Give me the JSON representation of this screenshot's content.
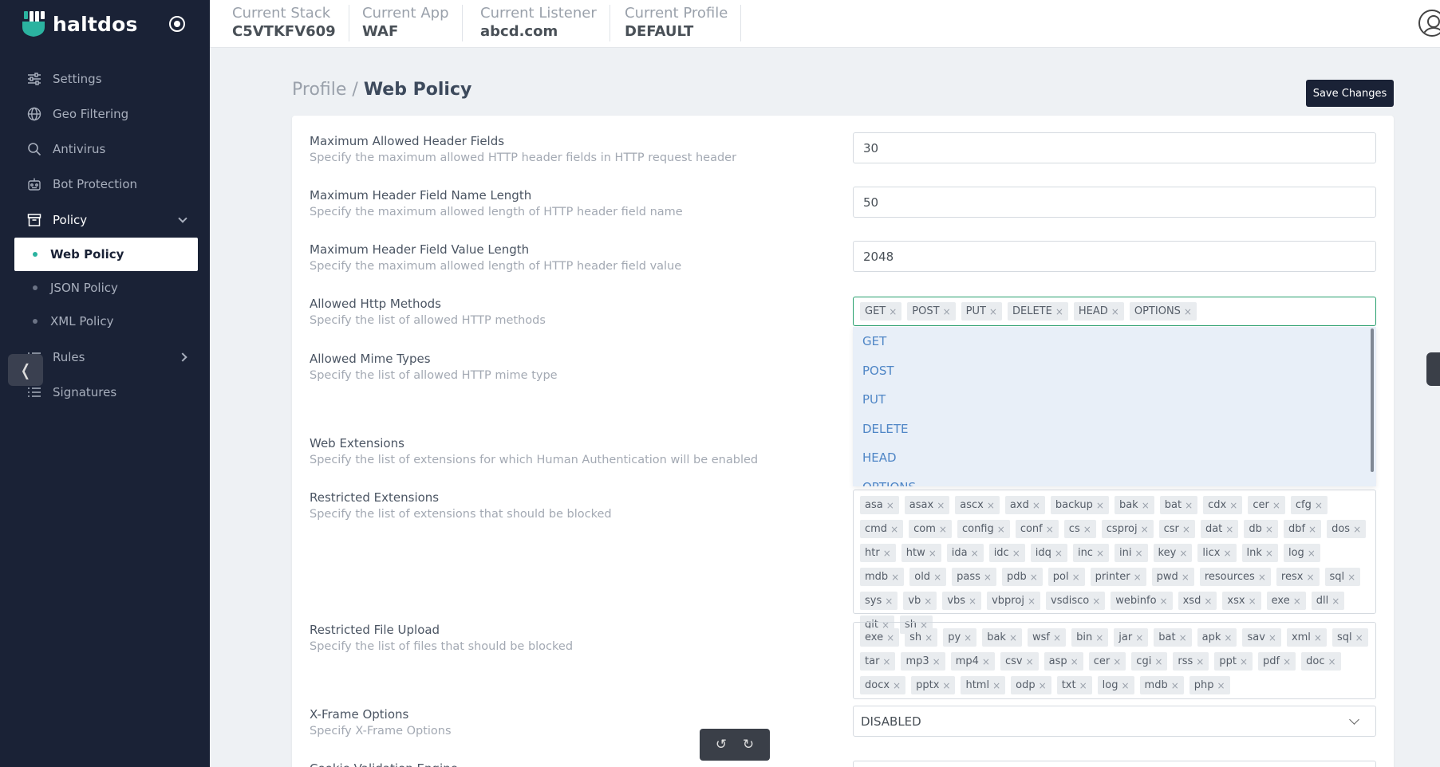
{
  "brand": {
    "name": "haltdos"
  },
  "sidebar": {
    "items": [
      {
        "label": "Settings",
        "icon": "sliders-icon"
      },
      {
        "label": "Geo Filtering",
        "icon": "globe-icon"
      },
      {
        "label": "Antivirus",
        "icon": "search-icon"
      },
      {
        "label": "Bot Protection",
        "icon": "robot-icon"
      },
      {
        "label": "Policy",
        "icon": "archive-icon"
      },
      {
        "label": "Rules",
        "icon": "list-icon"
      },
      {
        "label": "Signatures",
        "icon": "list-icon"
      }
    ],
    "policy_sub": [
      {
        "label": "Web Policy"
      },
      {
        "label": "JSON Policy"
      },
      {
        "label": "XML Policy"
      }
    ]
  },
  "topbar": {
    "stack": {
      "label": "Current Stack",
      "value": "C5VTKFV609"
    },
    "app": {
      "label": "Current App",
      "value": "WAF"
    },
    "listener": {
      "label": "Current Listener",
      "value": "abcd.com"
    },
    "profile": {
      "label": "Current Profile",
      "value": "DEFAULT"
    }
  },
  "page": {
    "breadcrumb_parent": "Profile",
    "breadcrumb_sep": " / ",
    "title": "Web Policy",
    "save_label": "Save Changes"
  },
  "fields": {
    "max_header_fields": {
      "label": "Maximum Allowed Header Fields",
      "desc": "Specify the maximum allowed HTTP header fields in HTTP request header",
      "value": "30"
    },
    "max_name_len": {
      "label": "Maximum Header Field Name Length",
      "desc": "Specify the maximum allowed length of HTTP header field name",
      "value": "50"
    },
    "max_value_len": {
      "label": "Maximum Header Field Value Length",
      "desc": "Specify the maximum allowed length of HTTP header field value",
      "value": "2048"
    },
    "methods": {
      "label": "Allowed Http Methods",
      "desc": "Specify the list of allowed HTTP methods",
      "tags": [
        "GET",
        "POST",
        "PUT",
        "DELETE",
        "HEAD",
        "OPTIONS"
      ]
    },
    "mime": {
      "label": "Allowed Mime Types",
      "desc": "Specify the list of allowed HTTP mime type"
    },
    "web_ext": {
      "label": "Web Extensions",
      "desc": "Specify the list of extensions for which Human Authentication will be enabled"
    },
    "restricted_ext": {
      "label": "Restricted Extensions",
      "desc": "Specify the list of extensions that should be blocked",
      "tags": [
        "asa",
        "asax",
        "ascx",
        "axd",
        "backup",
        "bak",
        "bat",
        "cdx",
        "cer",
        "cfg",
        "cmd",
        "com",
        "config",
        "conf",
        "cs",
        "csproj",
        "csr",
        "dat",
        "db",
        "dbf",
        "dos",
        "htr",
        "htw",
        "ida",
        "idc",
        "idq",
        "inc",
        "ini",
        "key",
        "licx",
        "lnk",
        "log",
        "mdb",
        "old",
        "pass",
        "pdb",
        "pol",
        "printer",
        "pwd",
        "resources",
        "resx",
        "sql",
        "sys",
        "vb",
        "vbs",
        "vbproj",
        "vsdisco",
        "webinfo",
        "xsd",
        "xsx",
        "exe",
        "dll",
        "git",
        "sh"
      ]
    },
    "restricted_upload": {
      "label": "Restricted File Upload",
      "desc": "Specify the list of files that should be blocked",
      "tags": [
        "exe",
        "sh",
        "py",
        "bak",
        "wsf",
        "bin",
        "jar",
        "bat",
        "apk",
        "sav",
        "xml",
        "sql",
        "tar",
        "mp3",
        "mp4",
        "csv",
        "asp",
        "cer",
        "cgi",
        "rss",
        "ppt",
        "pdf",
        "doc",
        "docx",
        "pptx",
        "html",
        "odp",
        "txt",
        "log",
        "mdb",
        "php"
      ]
    },
    "xframe": {
      "label": "X-Frame Options",
      "desc": "Specify X-Frame Options",
      "value": "DISABLED"
    },
    "cookie": {
      "label": "Cookie Validation Engine"
    }
  },
  "dropdown": {
    "options": [
      "GET",
      "POST",
      "PUT",
      "DELETE",
      "HEAD",
      "OPTIONS"
    ]
  },
  "tag_remove_glyph": "×",
  "collapse_glyph": "❬",
  "toolbar": {
    "undo_glyph": "↺",
    "redo_glyph": "↻"
  },
  "colors": {
    "sidebar_bg": "#1a2236",
    "accent": "#2bb3a0",
    "focus_border": "#28a06e",
    "link": "#4f86c6"
  }
}
